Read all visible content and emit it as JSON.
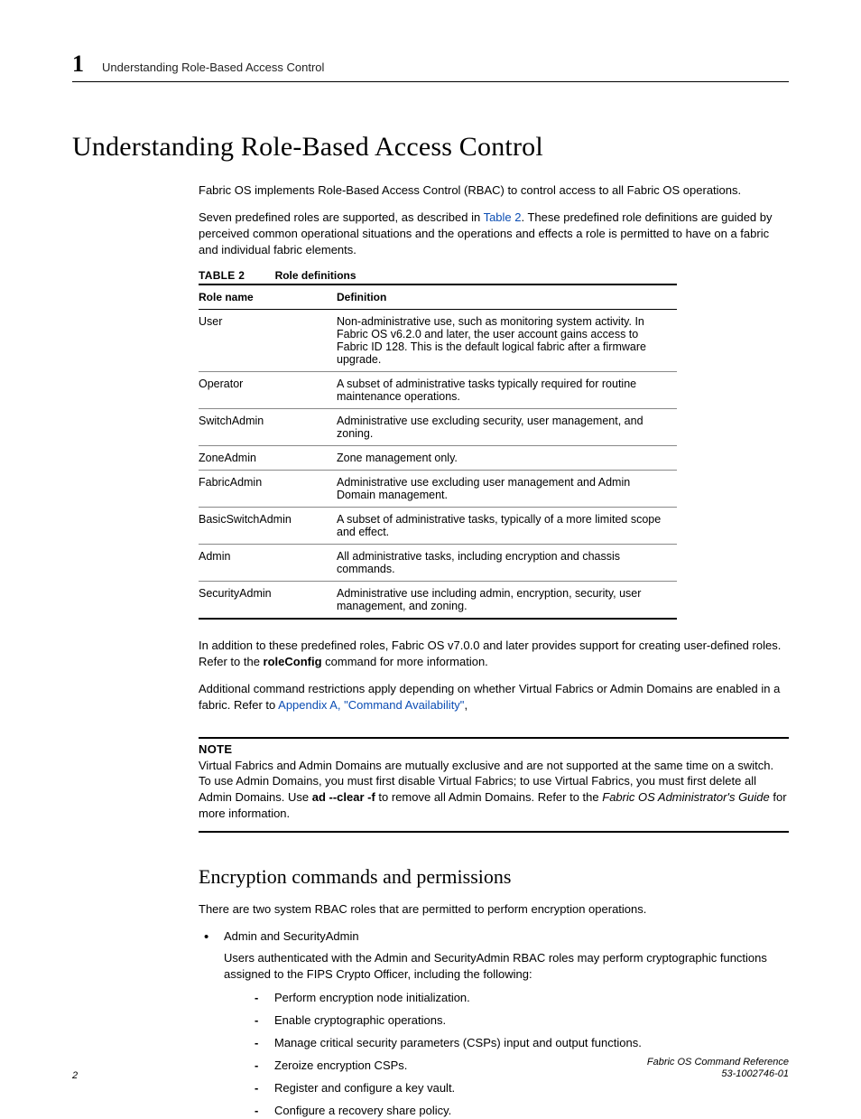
{
  "header": {
    "chapter_number": "1",
    "chapter_title": "Understanding Role-Based Access Control"
  },
  "main_heading": "Understanding Role-Based Access Control",
  "intro_p1": "Fabric OS implements Role-Based Access Control (RBAC) to control access to all Fabric OS operations.",
  "intro_p2_a": "Seven predefined roles are supported, as described in ",
  "intro_p2_link": "Table 2",
  "intro_p2_b": ". These predefined role definitions are guided by perceived common operational situations and the operations and effects a role is permitted to have on a fabric and individual fabric elements.",
  "table": {
    "label": "TABLE 2",
    "title": "Role definitions",
    "head_col1": "Role name",
    "head_col2": "Definition",
    "rows": [
      {
        "name": "User",
        "def": "Non-administrative use, such as monitoring system activity. In Fabric OS v6.2.0 and later, the user account gains access to Fabric ID 128. This is the default logical fabric after a firmware upgrade."
      },
      {
        "name": "Operator",
        "def": "A subset of administrative tasks typically required for routine maintenance operations."
      },
      {
        "name": "SwitchAdmin",
        "def": "Administrative use excluding security, user management, and zoning."
      },
      {
        "name": "ZoneAdmin",
        "def": "Zone management only."
      },
      {
        "name": "FabricAdmin",
        "def": "Administrative use excluding user management and Admin Domain management."
      },
      {
        "name": "BasicSwitchAdmin",
        "def": "A subset of administrative tasks, typically of a more limited scope and effect."
      },
      {
        "name": "Admin",
        "def": "All administrative tasks, including encryption and chassis commands."
      },
      {
        "name": "SecurityAdmin",
        "def": "Administrative use including admin, encryption, security, user management, and zoning."
      }
    ]
  },
  "after1_a": "In addition to these predefined roles, Fabric OS v7.0.0 and later provides support for creating user-defined roles. Refer to the ",
  "after1_bold": "roleConfig",
  "after1_b": " command for more information.",
  "after2_a": "Additional command restrictions apply depending on whether Virtual Fabrics or Admin Domains are enabled in a fabric. Refer to ",
  "after2_link": "Appendix A, \"Command Availability\"",
  "after2_b": ",",
  "note": {
    "label": "NOTE",
    "body_a": "Virtual Fabrics and Admin Domains are mutually exclusive and are not supported at the same time on a switch. To use Admin Domains, you must first disable Virtual Fabrics; to use Virtual Fabrics, you must first delete all Admin Domains. Use ",
    "body_bold": "ad --clear -f",
    "body_b": " to remove all Admin Domains. Refer to the ",
    "body_ital": "Fabric OS Administrator's Guide",
    "body_c": " for more information."
  },
  "sub_heading": "Encryption commands and permissions",
  "enc_intro": "There are two system RBAC roles that are permitted to perform encryption operations.",
  "enc_bullet_title": "Admin and SecurityAdmin",
  "enc_bullet_body": "Users authenticated with the Admin and SecurityAdmin RBAC roles may perform cryptographic functions assigned to the FIPS Crypto Officer, including the following:",
  "enc_sub": [
    "Perform encryption node initialization.",
    "Enable cryptographic operations.",
    "Manage critical security parameters (CSPs) input and output functions.",
    "Zeroize encryption CSPs.",
    "Register and configure a key vault.",
    "Configure a recovery share policy."
  ],
  "footer": {
    "page": "2",
    "doc_title": "Fabric OS Command Reference",
    "doc_num": "53-1002746-01"
  }
}
